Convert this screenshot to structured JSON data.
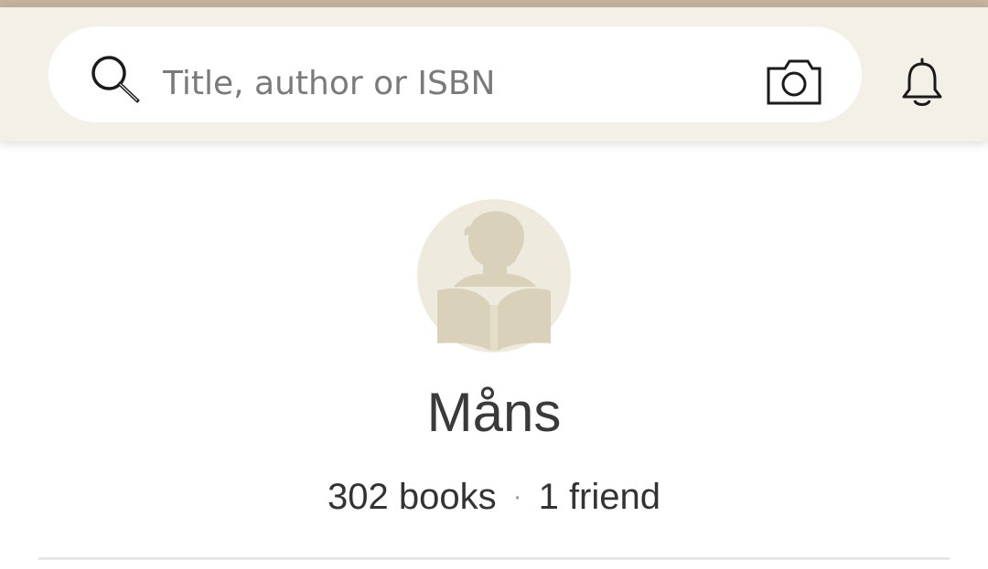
{
  "search": {
    "placeholder": "Title, author or ISBN",
    "value": "",
    "icon": "search-icon",
    "camera_icon": "camera-icon"
  },
  "header": {
    "notifications_icon": "bell-icon"
  },
  "profile": {
    "avatar_icon": "reader-avatar-icon",
    "name": "Måns",
    "books": "302 books",
    "separator": "·",
    "friends": "1 friend"
  },
  "colors": {
    "top_stripe": "#c4b29f",
    "header_bg": "#f3f0e8",
    "avatar_bg": "#eeebde",
    "avatar_figure": "#d9d1b9"
  }
}
